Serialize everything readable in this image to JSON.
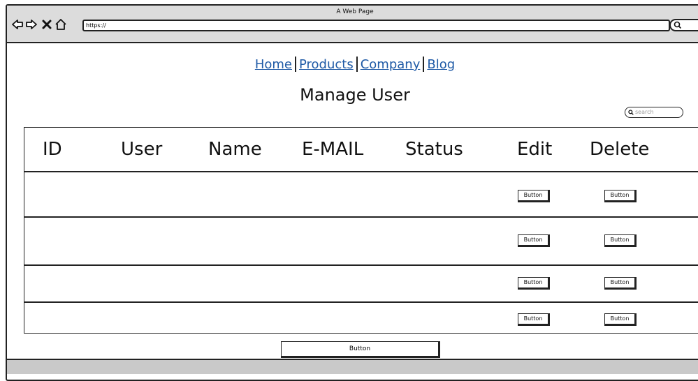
{
  "window": {
    "title": "A Web Page"
  },
  "browser": {
    "url": "https://",
    "back_icon": "left-arrow-icon",
    "forward_icon": "right-arrow-icon",
    "stop_icon": "x-icon",
    "home_icon": "home-icon",
    "search_icon": "search-icon"
  },
  "nav": {
    "links": [
      "Home",
      "Products",
      "Company",
      "Blog"
    ]
  },
  "page": {
    "title": "Manage User"
  },
  "search": {
    "placeholder": "search"
  },
  "table": {
    "columns": [
      "ID",
      "User",
      "Name",
      "E-MAIL",
      "Status",
      "Edit",
      "Delete"
    ],
    "rows": [
      {
        "edit_label": "Button",
        "delete_label": "Button"
      },
      {
        "edit_label": "Button",
        "delete_label": "Button"
      },
      {
        "edit_label": "Button",
        "delete_label": "Button"
      },
      {
        "edit_label": "Button",
        "delete_label": "Button"
      }
    ]
  },
  "footer": {
    "button_label": "Button"
  }
}
